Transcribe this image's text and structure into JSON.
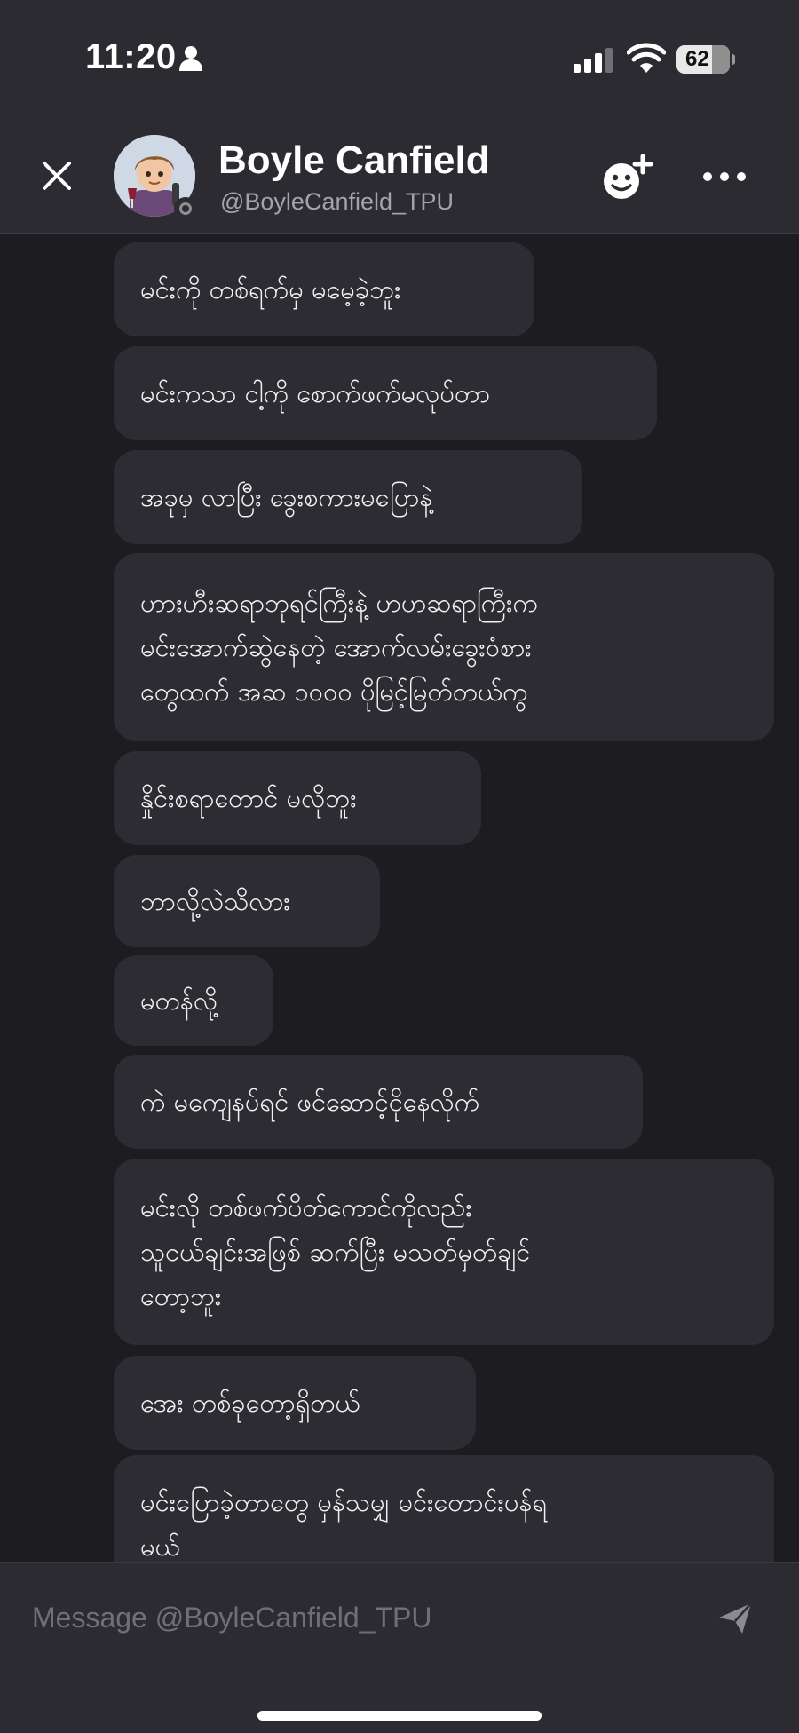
{
  "status_bar": {
    "time": "11:20",
    "battery_level": "62",
    "icons": [
      "person-icon",
      "cellular-signal-icon",
      "wifi-icon",
      "battery-icon"
    ]
  },
  "header": {
    "contact_name": "Boyle Canfield",
    "contact_handle": "@BoyleCanfield_TPU",
    "icons": [
      "close-icon",
      "avatar",
      "presence-status-icon",
      "add-friend-icon",
      "more-options-icon"
    ]
  },
  "messages": [
    "မင်းကို တစ်ရက်မှ မမေ့ခဲ့ဘူး",
    "မင်းကသာ ငါ့ကို စောက်ဖက်မလုပ်တာ",
    "အခုမှ လာပြီး ခွေးစကားမပြောနဲ့",
    "ဟားဟီးဆရာဘုရင်ကြီးနဲ့ ဟဟဆရာကြီးက\nမင်းအောက်ဆွဲနေတဲ့ အောက်လမ်းခွေးဝံစား\nတွေထက် အဆ ၁၀၀၀ ပိုမြင့်မြတ်တယ်ကွ",
    "နှိုင်းစရာတောင် မလိုဘူး",
    "ဘာလို့လဲသိလား",
    "မတန်လို့",
    "ကဲ မကျေနပ်ရင် ဖင်ဆောင့်ငိုနေလိုက်",
    "မင်းလို တစ်ဖက်ပိတ်ကောင်ကိုလည်း\nသူငယ်ချင်းအဖြစ် ဆက်ပြီး မသတ်မှတ်ချင်\nတော့ဘူး",
    "အေး တစ်ခုတော့ရှိတယ်",
    "မင်းပြောခဲ့တာတွေ မှန်သမျှ မင်းတောင်းပန်ရ\nမယ်"
  ],
  "composer": {
    "placeholder": "Message @BoyleCanfield_TPU",
    "send_icon": "send-icon"
  }
}
